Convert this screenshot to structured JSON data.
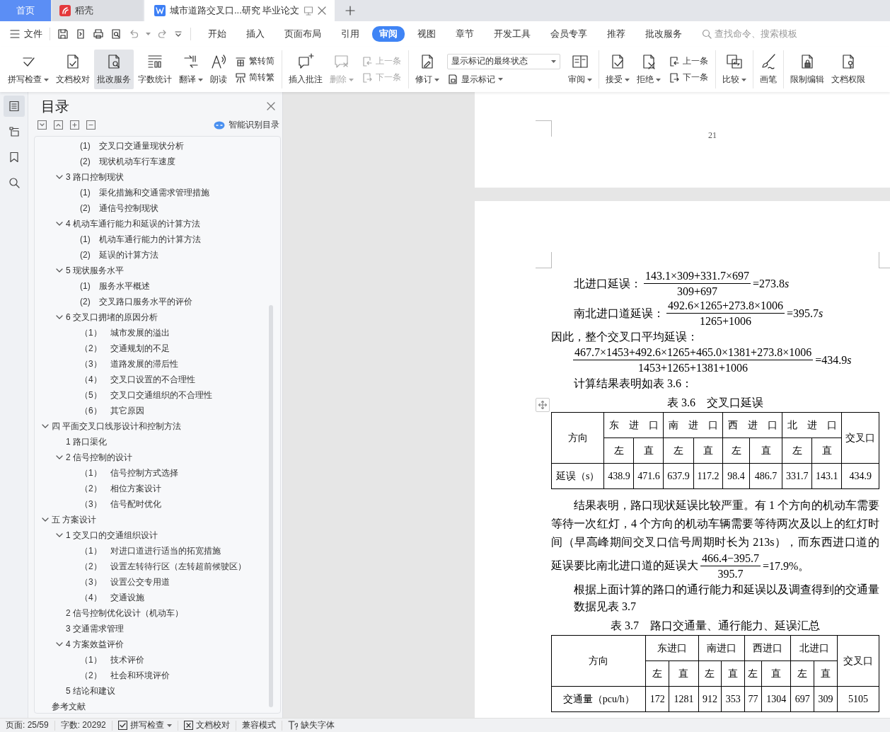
{
  "tabs": [
    {
      "kind": "home",
      "label": "首页",
      "selected": false
    },
    {
      "kind": "app",
      "label": "稻壳",
      "selected": false
    },
    {
      "kind": "doc",
      "label": "城市道路交叉口...研究 毕业论文",
      "selected": true
    }
  ],
  "menu": {
    "file": "文件",
    "tabs": [
      {
        "label": "开始",
        "selected": false
      },
      {
        "label": "插入",
        "selected": false
      },
      {
        "label": "页面布局",
        "selected": false
      },
      {
        "label": "引用",
        "selected": false
      },
      {
        "label": "审阅",
        "selected": true
      },
      {
        "label": "视图",
        "selected": false
      },
      {
        "label": "章节",
        "selected": false
      },
      {
        "label": "开发工具",
        "selected": false
      },
      {
        "label": "会员专享",
        "selected": false
      },
      {
        "label": "推荐",
        "selected": false
      },
      {
        "label": "批改服务",
        "selected": false
      }
    ],
    "search": {
      "placeholder": "查找命令、搜索模板"
    }
  },
  "ribbon": [
    {
      "kind": "big",
      "label": "拼写检查",
      "caret": true,
      "selected": false,
      "disabled": false
    },
    {
      "kind": "big",
      "label": "文档校对",
      "caret": false,
      "selected": false,
      "disabled": false
    },
    {
      "kind": "big",
      "label": "批改服务",
      "caret": false,
      "selected": true,
      "disabled": false
    },
    {
      "kind": "big",
      "label": "字数统计",
      "caret": false,
      "selected": false,
      "disabled": false
    },
    {
      "kind": "big",
      "label": "翻译",
      "caret": true,
      "selected": false,
      "disabled": false
    },
    {
      "kind": "big",
      "label": "朗读",
      "caret": false,
      "selected": false,
      "disabled": false
    },
    {
      "kind": "pair",
      "rows": [
        {
          "label": "繁转简",
          "disabled": false
        },
        {
          "label": "简转繁",
          "disabled": false
        }
      ]
    },
    {
      "kind": "separator"
    },
    {
      "kind": "big",
      "label": "插入批注",
      "caret": false,
      "selected": false,
      "disabled": false
    },
    {
      "kind": "big",
      "label": "删除",
      "caret": true,
      "selected": false,
      "disabled": true
    },
    {
      "kind": "pair",
      "rows": [
        {
          "label": "上一条",
          "disabled": true
        },
        {
          "label": "下一条",
          "disabled": true
        }
      ]
    },
    {
      "kind": "separator"
    },
    {
      "kind": "big",
      "label": "修订",
      "caret": true,
      "selected": false,
      "disabled": false
    },
    {
      "kind": "markup",
      "value": "显示标记的最终状态",
      "label": "显示标记",
      "caret": true
    },
    {
      "kind": "big",
      "label": "审阅",
      "caret": true,
      "selected": false,
      "disabled": false
    },
    {
      "kind": "separator"
    },
    {
      "kind": "big",
      "label": "接受",
      "caret": true,
      "selected": false,
      "disabled": false
    },
    {
      "kind": "big",
      "label": "拒绝",
      "caret": true,
      "selected": false,
      "disabled": false
    },
    {
      "kind": "pair",
      "rows": [
        {
          "label": "上一条",
          "disabled": false
        },
        {
          "label": "下一条",
          "disabled": false
        }
      ]
    },
    {
      "kind": "separator"
    },
    {
      "kind": "big",
      "label": "比较",
      "caret": true,
      "selected": false,
      "disabled": false
    },
    {
      "kind": "separator"
    },
    {
      "kind": "big",
      "label": "画笔",
      "caret": false,
      "selected": false,
      "disabled": false
    },
    {
      "kind": "separator"
    },
    {
      "kind": "big",
      "label": "限制编辑",
      "caret": false,
      "selected": false,
      "disabled": false
    },
    {
      "kind": "big",
      "label": "文档权限",
      "caret": false,
      "selected": false,
      "disabled": false
    }
  ],
  "rail": [
    {
      "selected": true
    },
    {
      "selected": false
    },
    {
      "selected": false
    },
    {
      "selected": false
    }
  ],
  "sidebar": {
    "title": "目录",
    "smart_button": "智能识别目录",
    "toc": [
      {
        "children": [
          {
            "children": [
              {
                "label": "(1)　交叉口交通量现状分析"
              },
              {
                "label": "(2)　现状机动车行车速度"
              }
            ]
          },
          {
            "label": "3 路口控制现状",
            "expanded": true,
            "children": [
              {
                "label": "(1)　渠化措施和交通需求管理措施"
              },
              {
                "label": "(2)　通信号控制现状"
              }
            ]
          },
          {
            "label": "4 机动车通行能力和延误的计算方法",
            "expanded": true,
            "children": [
              {
                "label": "(1)　机动车通行能力的计算方法"
              },
              {
                "label": "(2)　延误的计算方法"
              }
            ]
          },
          {
            "label": "5 现状服务水平",
            "expanded": true,
            "children": [
              {
                "label": "(1)　服务水平概述"
              },
              {
                "label": "(2)　交叉路口服务水平的评价"
              }
            ]
          },
          {
            "label": "6 交叉口拥堵的原因分析",
            "expanded": true,
            "children": [
              {
                "label": "（1）　城市发展的溢出"
              },
              {
                "label": "（2）　交通规划的不足"
              },
              {
                "label": "（3）　道路发展的滞后性"
              },
              {
                "label": "（4）　交叉口设置的不合理性"
              },
              {
                "label": "（5）　交叉口交通组织的不合理性"
              },
              {
                "label": "（6）　其它原因"
              }
            ]
          }
        ]
      },
      {
        "label": "四 平面交叉口线形设计和控制方法",
        "expanded": true,
        "children": [
          {
            "label": "1 路口渠化"
          },
          {
            "label": "2 信号控制的设计",
            "expanded": true,
            "children": [
              {
                "label": "（1）　信号控制方式选择"
              },
              {
                "label": "（2）　相位方案设计"
              },
              {
                "label": "（3）　信号配时优化"
              }
            ]
          }
        ]
      },
      {
        "label": "五 方案设计",
        "expanded": true,
        "children": [
          {
            "label": "1 交叉口的交通组织设计",
            "expanded": true,
            "children": [
              {
                "label": "（1）　对进口道进行适当的拓宽措施"
              },
              {
                "label": "（2）　设置左转待行区（左转超前候驶区）"
              },
              {
                "label": "（3）　设置公交专用道"
              },
              {
                "label": "（4）　交通设施"
              }
            ]
          },
          {
            "label": "2 信号控制优化设计（机动车）"
          },
          {
            "label": "3 交通需求管理"
          },
          {
            "label": "4 方案效益评价",
            "expanded": true,
            "children": [
              {
                "label": "（1）　技术评价"
              },
              {
                "label": "（2）　社会和环境评价"
              }
            ]
          },
          {
            "label": "5 结论和建议"
          }
        ]
      },
      {
        "label": "参考文献"
      }
    ]
  },
  "document": {
    "page_number": "21",
    "blocks": [
      {
        "kind": "formula",
        "indent": true,
        "label": "北进口延误：",
        "numerator": "143.1×309+331.7×697",
        "denominator": "309+697",
        "result": "=273.8",
        "variable": "s"
      },
      {
        "kind": "formula",
        "indent": true,
        "label": "南北进口道延误：",
        "numerator": "492.6×1265+273.8×1006",
        "denominator": "1265+1006",
        "result": "=395.7",
        "variable": "s"
      },
      {
        "kind": "text",
        "indent": false,
        "text": "因此，整个交叉口平均延误："
      },
      {
        "kind": "formula",
        "indent": true,
        "numerator": "467.7×1453+492.6×1265+465.0×1381+273.8×1006",
        "denominator": "1453+1265+1381+1006",
        "result": "=434.9",
        "variable": "s"
      },
      {
        "kind": "text",
        "indent": true,
        "text": "计算结果表明如表 3.6："
      },
      {
        "kind": "caption",
        "text": "表 3.6　交叉口延误"
      },
      {
        "kind": "table",
        "corner": "方向",
        "groups": [
          {
            "label": "东　进　口",
            "sub": [
              "左",
              "直"
            ]
          },
          {
            "label": "南　进　口",
            "sub": [
              "左",
              "直"
            ]
          },
          {
            "label": "西　进　口",
            "sub": [
              "左",
              "直"
            ]
          },
          {
            "label": "北　进　口",
            "sub": [
              "左",
              "直"
            ]
          }
        ],
        "total": "交叉口",
        "rows": [
          {
            "label": "延误（s）",
            "cells": [
              "438.9",
              "471.6",
              "637.9",
              "117.2",
              "98.4",
              "486.7",
              "331.7",
              "143.1",
              "434.9"
            ]
          }
        ]
      },
      {
        "kind": "para_formula",
        "text": "结果表明，路口现状延误比较严重。有 1 个方向的机动车需要等待一次红灯，4 个方向的机动车辆需要等待两次及以上的红灯时间（早高峰期间交叉口信号周期时长为 213s），而东西进口道的延误要比南北进口道的延误大",
        "numerator": "466.4−395.7",
        "denominator": "395.7",
        "result": "=17.9%",
        "after": "。"
      },
      {
        "kind": "text",
        "indent": true,
        "text": "根据上面计算的路口的通行能力和延误以及调查得到的交通量数据见表 3.7"
      },
      {
        "kind": "caption",
        "text": "表 3.7　路口交通量、通行能力、延误汇总"
      },
      {
        "kind": "table",
        "corner": "方向",
        "groups": [
          {
            "label": "东进口",
            "sub": [
              "左",
              "直"
            ]
          },
          {
            "label": "南进口",
            "sub": [
              "左",
              "直"
            ]
          },
          {
            "label": "西进口",
            "sub": [
              "左",
              "直"
            ]
          },
          {
            "label": "北进口",
            "sub": [
              "左",
              "直"
            ]
          }
        ],
        "total": "交叉口",
        "rows": [
          {
            "label": "交通量（pcu/h）",
            "cells": [
              "172",
              "1281",
              "912",
              "353",
              "77",
              "1304",
              "697",
              "309",
              "5105"
            ]
          }
        ]
      }
    ]
  },
  "status_bar": [
    {
      "kind": "text",
      "label": "页面: 25/59"
    },
    {
      "kind": "text",
      "label": "字数: 20292"
    },
    {
      "kind": "spell",
      "label": "拼写检查",
      "caret": true
    },
    {
      "kind": "proof",
      "label": "文档校对",
      "caret": false
    },
    {
      "kind": "text",
      "label": "兼容模式"
    },
    {
      "kind": "font",
      "label": "缺失字体"
    }
  ]
}
